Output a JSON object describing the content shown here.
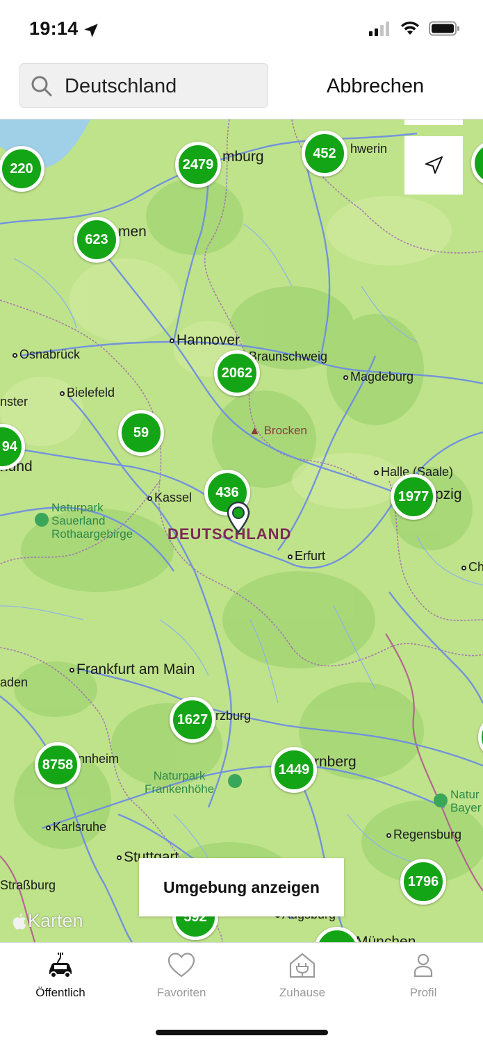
{
  "status": {
    "time": "19:14",
    "location_icon": "location-arrow-icon",
    "signal_icon": "cellular-signal-icon",
    "wifi_icon": "wifi-icon",
    "battery_icon": "battery-icon"
  },
  "search": {
    "value": "Deutschland",
    "cancel_label": "Abbrechen",
    "icon": "search-icon"
  },
  "map": {
    "country_label": "DEUTSCHLAND",
    "clusters": [
      "220",
      "2479",
      "452",
      "623",
      "2062",
      "59",
      "94",
      "436",
      "1977",
      "1627",
      "8758",
      "1449",
      "1796",
      "592"
    ],
    "cities": [
      "Hannover",
      "Osnabrück",
      "Braunschweig",
      "Magdeburg",
      "Bielefeld",
      "Kassel",
      "Halle (Saale)",
      "Erfurt",
      "Frankfurt am Main",
      "Karlsruhe",
      "Regensburg",
      "Stuttgart",
      "Straßburg"
    ],
    "partial_labels": [
      "mburg",
      "hwerin",
      "men",
      "nster",
      "hund",
      "pzig",
      "Ch",
      "aden",
      "rzburg",
      "nnheim",
      "rnberg",
      "Augsburg",
      "München",
      "Natur",
      "Bayer"
    ],
    "parks": [
      "Naturpark\nSauerland\nRothaargebirge",
      "Naturpark\nFrankenhöhe"
    ],
    "peak": "Brocken",
    "show_area_label": "Umgebung anzeigen",
    "attribution": "Karten",
    "locate_icon": "navigation-arrow-icon"
  },
  "tabs": [
    {
      "label": "Öffentlich",
      "icon": "electric-car-icon",
      "active": true
    },
    {
      "label": "Favoriten",
      "icon": "heart-icon",
      "active": false
    },
    {
      "label": "Zuhause",
      "icon": "home-charger-icon",
      "active": false
    },
    {
      "label": "Profil",
      "icon": "person-icon",
      "active": false
    }
  ],
  "colors": {
    "cluster_green": "#14a516",
    "map_land": "#bfe38a",
    "country_label": "#7d2a55"
  }
}
